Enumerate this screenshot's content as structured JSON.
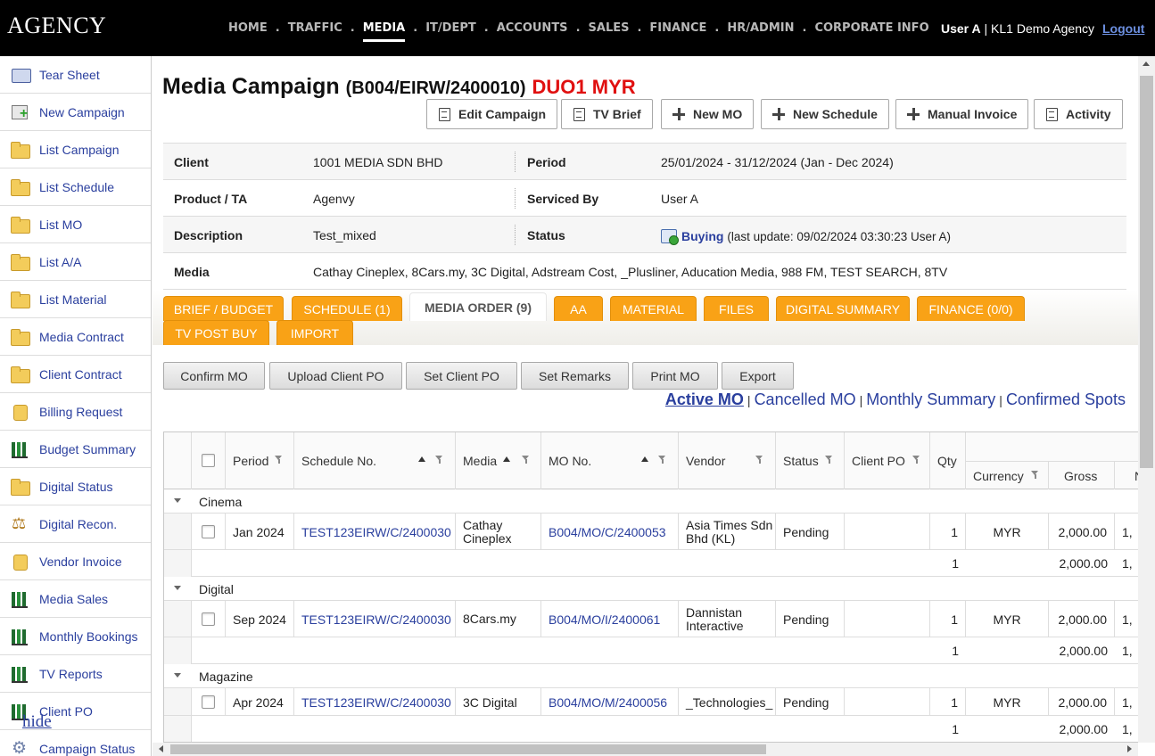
{
  "app": {
    "logo": "AGENCY"
  },
  "topnav": {
    "items": [
      {
        "label": "HOME"
      },
      {
        "label": "TRAFFIC"
      },
      {
        "label": "MEDIA",
        "active": true
      },
      {
        "label": "IT/DEPT"
      },
      {
        "label": "ACCOUNTS"
      },
      {
        "label": "SALES"
      },
      {
        "label": "FINANCE"
      },
      {
        "label": "HR/ADMIN"
      },
      {
        "label": "CORPORATE INFO"
      }
    ],
    "separator": ".",
    "user_name": "User A",
    "user_divider": " | ",
    "agency": "KL1 Demo Agency",
    "logout": "Logout"
  },
  "sidebar": {
    "items": [
      {
        "label": "Tear Sheet",
        "icon": "tear-sheet-icon"
      },
      {
        "label": "New Campaign",
        "icon": "new-campaign-icon"
      },
      {
        "label": "List Campaign",
        "icon": "folder-icon"
      },
      {
        "label": "List Schedule",
        "icon": "folder-icon"
      },
      {
        "label": "List MO",
        "icon": "folder-icon"
      },
      {
        "label": "List A/A",
        "icon": "folder-icon"
      },
      {
        "label": "List Material",
        "icon": "folder-icon"
      },
      {
        "label": "Media Contract",
        "icon": "folder-icon"
      },
      {
        "label": "Client Contract",
        "icon": "folder-icon"
      },
      {
        "label": "Billing Request",
        "icon": "billing-icon"
      },
      {
        "label": "Budget Summary",
        "icon": "bar-chart-icon"
      },
      {
        "label": "Digital Status",
        "icon": "folder-icon"
      },
      {
        "label": "Digital Recon.",
        "icon": "scale-icon"
      },
      {
        "label": "Vendor Invoice",
        "icon": "billing-icon"
      },
      {
        "label": "Media Sales",
        "icon": "bar-chart-icon"
      },
      {
        "label": "Monthly Bookings",
        "icon": "bar-chart-icon"
      },
      {
        "label": "TV Reports",
        "icon": "bar-chart-icon"
      },
      {
        "label": "Client PO",
        "icon": "bar-chart-icon"
      },
      {
        "label": "Campaign Status",
        "icon": "gear-icon"
      }
    ],
    "hide_label": "hide"
  },
  "page": {
    "title": "Media Campaign",
    "code": "(B004/EIRW/2400010)",
    "tag": "DUO1 MYR"
  },
  "actions": [
    {
      "label": "Edit Campaign",
      "icon": "document-icon"
    },
    {
      "label": "TV Brief",
      "icon": "document-icon"
    },
    {
      "label": "New MO",
      "icon": "plus-icon"
    },
    {
      "label": "New Schedule",
      "icon": "plus-icon"
    },
    {
      "label": "Manual Invoice",
      "icon": "plus-icon"
    },
    {
      "label": "Activity",
      "icon": "document-icon"
    }
  ],
  "info": {
    "client_label": "Client",
    "client": "1001 MEDIA SDN BHD",
    "period_label": "Period",
    "period": "25/01/2024 - 31/12/2024 (Jan - Dec 2024)",
    "product_label": "Product / TA",
    "product": "Agenvy",
    "serviced_label": "Serviced By",
    "serviced": "User A",
    "description_label": "Description",
    "description": "Test_mixed",
    "status_label": "Status",
    "status": "Buying",
    "status_note": "(last update: 09/02/2024 03:30:23 User A)",
    "media_label": "Media",
    "media": "Cathay Cineplex, 8Cars.my, 3C Digital, Adstream Cost, _Plusliner, Aducation Media, 988 FM, TEST SEARCH, 8TV"
  },
  "tabs": [
    {
      "label": "BRIEF / BUDGET"
    },
    {
      "label": "SCHEDULE (1)"
    },
    {
      "label": "MEDIA ORDER (9)",
      "active": true
    },
    {
      "label": "AA"
    },
    {
      "label": "MATERIAL"
    },
    {
      "label": "FILES"
    },
    {
      "label": "DIGITAL SUMMARY"
    },
    {
      "label": "FINANCE (0/0)"
    },
    {
      "label": "TV POST BUY"
    },
    {
      "label": "IMPORT"
    }
  ],
  "mo_buttons": [
    {
      "label": "Confirm MO"
    },
    {
      "label": "Upload Client PO"
    },
    {
      "label": "Set Client PO"
    },
    {
      "label": "Set Remarks"
    },
    {
      "label": "Print MO"
    },
    {
      "label": "Export"
    }
  ],
  "filters": {
    "active": "Active MO",
    "cancelled": "Cancelled MO",
    "monthly": "Monthly Summary",
    "confirmed": "Confirmed Spots",
    "sep": "|"
  },
  "grid": {
    "columns": [
      "Period",
      "Schedule No.",
      "Media",
      "MO No.",
      "Vendor",
      "Status",
      "Client PO",
      "Qty",
      "Currency",
      "Gross",
      "N"
    ],
    "groups": [
      {
        "name": "Cinema",
        "row": {
          "period": "Jan 2024",
          "schedule": "TEST123EIRW/C/2400030",
          "media": "Cathay Cineplex",
          "mo": "B004/MO/C/2400053",
          "vendor": "Asia Times Sdn Bhd (KL)",
          "status": "Pending",
          "client_po": "",
          "qty": "1",
          "currency": "MYR",
          "gross": "2,000.00",
          "net": "1,"
        },
        "subtotal": {
          "qty": "1",
          "gross": "2,000.00",
          "net": "1,"
        }
      },
      {
        "name": "Digital",
        "row": {
          "period": "Sep 2024",
          "schedule": "TEST123EIRW/C/2400030",
          "media": "8Cars.my",
          "mo": "B004/MO/I/2400061",
          "vendor": "Dannistan Interactive",
          "status": "Pending",
          "client_po": "",
          "qty": "1",
          "currency": "MYR",
          "gross": "2,000.00",
          "net": "1,"
        },
        "subtotal": {
          "qty": "1",
          "gross": "2,000.00",
          "net": "1,"
        }
      },
      {
        "name": "Magazine",
        "row": {
          "period": "Apr 2024",
          "schedule": "TEST123EIRW/C/2400030",
          "media": "3C Digital",
          "mo": "B004/MO/M/2400056",
          "vendor": "_Technologies_",
          "status": "Pending",
          "client_po": "",
          "qty": "1",
          "currency": "MYR",
          "gross": "2,000.00",
          "net": "1,"
        },
        "subtotal": {
          "qty": "1",
          "gross": "2,000.00",
          "net": "1,"
        }
      }
    ]
  }
}
